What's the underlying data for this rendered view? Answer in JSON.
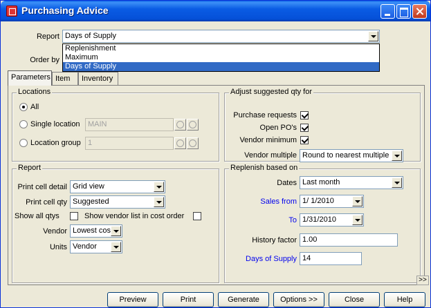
{
  "window": {
    "title": "Purchasing Advice"
  },
  "top": {
    "report_label": "Report",
    "report_value": "Days of Supply",
    "order_by_label": "Order by",
    "report_options": [
      "Replenishment",
      "Maximum",
      "Days of Supply"
    ],
    "selected_option": "Days of Supply"
  },
  "tabs": [
    {
      "label": "Parameters",
      "active": true
    },
    {
      "label": "Item",
      "active": false
    },
    {
      "label": "Inventory",
      "active": false
    }
  ],
  "locations": {
    "title": "Locations",
    "all_label": "All",
    "single_label": "Single location",
    "single_value": "MAIN",
    "group_label": "Location group",
    "group_value": "1",
    "selected": "All"
  },
  "adjust": {
    "title": "Adjust suggested qty for",
    "purchase_requests_label": "Purchase requests",
    "purchase_requests_checked": true,
    "open_pos_label": "Open PO's",
    "open_pos_checked": true,
    "vendor_minimum_label": "Vendor minimum",
    "vendor_minimum_checked": true,
    "vendor_multiple_label": "Vendor multiple",
    "vendor_multiple_value": "Round to nearest multiple"
  },
  "report": {
    "title": "Report",
    "print_cell_detail_label": "Print cell detail",
    "print_cell_detail_value": "Grid view",
    "print_cell_qty_label": "Print cell qty",
    "print_cell_qty_value": "Suggested",
    "show_all_qtys_label": "Show all qtys",
    "show_all_qtys_checked": false,
    "show_vendor_list_label": "Show vendor list in cost order",
    "show_vendor_list_checked": false,
    "vendor_label": "Vendor",
    "vendor_value": "Lowest cost",
    "units_label": "Units",
    "units_value": "Vendor"
  },
  "replenish": {
    "title": "Replenish based on",
    "dates_label": "Dates",
    "dates_value": "Last month",
    "sales_from_label": "Sales from",
    "sales_from_value": "1/ 1/2010",
    "to_label": "To",
    "to_value": "1/31/2010",
    "history_factor_label": "History factor",
    "history_factor_value": "1.00",
    "days_of_supply_label": "Days of Supply",
    "days_of_supply_value": "14"
  },
  "expand_label": ">>",
  "buttons": {
    "preview": "Preview",
    "print": "Print",
    "generate": "Generate",
    "options": "Options >>",
    "close": "Close",
    "help": "Help"
  }
}
